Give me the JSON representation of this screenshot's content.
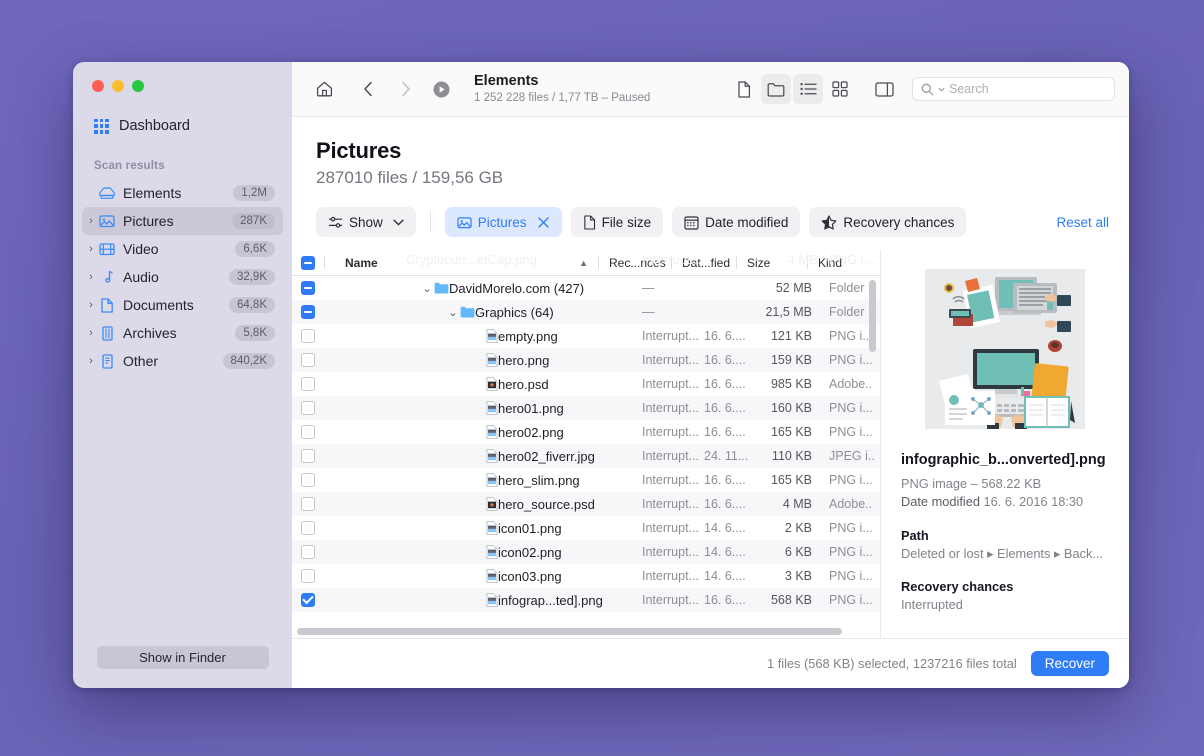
{
  "window": {
    "traffic_lights": [
      "close",
      "minimize",
      "zoom"
    ],
    "accent": "#2f7df6"
  },
  "sidebar": {
    "dashboard_label": "Dashboard",
    "section_title": "Scan results",
    "items": [
      {
        "label": "Elements",
        "badge": "1,2M",
        "icon": "disk-icon",
        "expandable": false,
        "selected": false
      },
      {
        "label": "Pictures",
        "badge": "287K",
        "icon": "picture-icon",
        "expandable": true,
        "selected": true
      },
      {
        "label": "Video",
        "badge": "6,6K",
        "icon": "video-icon",
        "expandable": true,
        "selected": false
      },
      {
        "label": "Audio",
        "badge": "32,9K",
        "icon": "audio-icon",
        "expandable": true,
        "selected": false
      },
      {
        "label": "Documents",
        "badge": "64,8K",
        "icon": "document-icon",
        "expandable": true,
        "selected": false
      },
      {
        "label": "Archives",
        "badge": "5,8K",
        "icon": "archive-icon",
        "expandable": true,
        "selected": false
      },
      {
        "label": "Other",
        "badge": "840,2K",
        "icon": "other-icon",
        "expandable": true,
        "selected": false
      }
    ],
    "show_in_finder_label": "Show in Finder"
  },
  "toolbar": {
    "home_icon": "home-icon",
    "back_icon": "chevron-left-icon",
    "forward_icon": "chevron-right-icon",
    "play_icon": "play-circle-icon",
    "title": "Elements",
    "subtitle": "1 252 228 files / 1,77 TB – Paused",
    "view_buttons": [
      {
        "name": "file-view-icon",
        "active": false
      },
      {
        "name": "folder-view-icon",
        "active": true
      },
      {
        "name": "list-view-icon",
        "active": true
      },
      {
        "name": "grid-view-icon",
        "active": false
      }
    ],
    "sidebar_toggle_icon": "sidebar-toggle-icon",
    "search_placeholder": "Search",
    "search_value": ""
  },
  "header": {
    "title": "Pictures",
    "subtitle": "287010 files / 159,56 GB"
  },
  "filters": {
    "show_label": "Show",
    "chips": [
      {
        "label": "Pictures",
        "icon": "picture-icon",
        "active": true,
        "removable": true
      },
      {
        "label": "File size",
        "icon": "document-icon",
        "active": false,
        "removable": false
      },
      {
        "label": "Date modified",
        "icon": "calendar-icon",
        "active": false,
        "removable": false
      },
      {
        "label": "Recovery chances",
        "icon": "star-icon",
        "active": false,
        "removable": false
      }
    ],
    "reset_label": "Reset all"
  },
  "table": {
    "columns": [
      "Name",
      "Rec...nces",
      "Dat...fied",
      "Size",
      "Kind"
    ],
    "sort_column": "Name",
    "sort_direction": "asc",
    "header_checkbox_state": "mixed",
    "ghost_row_name": "Cryptocurr...etCap.png",
    "ghost_row_rec": "Interrupt...",
    "ghost_row_size": "4 MB",
    "ghost_row_kind": "PNG i...",
    "rows": [
      {
        "check": "mixed",
        "indent": 0,
        "disclosure": "open",
        "type": "folder",
        "name": "DavidMorelo.com (427)",
        "rec": "",
        "date": "",
        "size": "52 MB",
        "kind": "Folder",
        "dash": "—"
      },
      {
        "check": "mixed",
        "indent": 1,
        "disclosure": "open",
        "type": "folder",
        "name": "Graphics (64)",
        "rec": "",
        "date": "",
        "size": "21,5 MB",
        "kind": "Folder",
        "dash": "—"
      },
      {
        "check": "unchecked",
        "indent": 2,
        "disclosure": "none",
        "type": "png",
        "name": "empty.png",
        "rec": "Interrupt...",
        "date": "16. 6....",
        "size": "121 KB",
        "kind": "PNG i...",
        "dash": ""
      },
      {
        "check": "unchecked",
        "indent": 2,
        "disclosure": "none",
        "type": "png",
        "name": "hero.png",
        "rec": "Interrupt...",
        "date": "16. 6....",
        "size": "159 KB",
        "kind": "PNG i...",
        "dash": ""
      },
      {
        "check": "unchecked",
        "indent": 2,
        "disclosure": "none",
        "type": "psd",
        "name": "hero.psd",
        "rec": "Interrupt...",
        "date": "16. 6....",
        "size": "985 KB",
        "kind": "Adobe..",
        "dash": ""
      },
      {
        "check": "unchecked",
        "indent": 2,
        "disclosure": "none",
        "type": "png",
        "name": "hero01.png",
        "rec": "Interrupt...",
        "date": "16. 6....",
        "size": "160 KB",
        "kind": "PNG i...",
        "dash": ""
      },
      {
        "check": "unchecked",
        "indent": 2,
        "disclosure": "none",
        "type": "png",
        "name": "hero02.png",
        "rec": "Interrupt...",
        "date": "16. 6....",
        "size": "165 KB",
        "kind": "PNG i...",
        "dash": ""
      },
      {
        "check": "unchecked",
        "indent": 2,
        "disclosure": "none",
        "type": "png",
        "name": "hero02_fiverr.jpg",
        "rec": "Interrupt...",
        "date": "24. 11...",
        "size": "110 KB",
        "kind": "JPEG i..",
        "dash": ""
      },
      {
        "check": "unchecked",
        "indent": 2,
        "disclosure": "none",
        "type": "png",
        "name": "hero_slim.png",
        "rec": "Interrupt...",
        "date": "16. 6....",
        "size": "165 KB",
        "kind": "PNG i...",
        "dash": ""
      },
      {
        "check": "unchecked",
        "indent": 2,
        "disclosure": "none",
        "type": "psd",
        "name": "hero_source.psd",
        "rec": "Interrupt...",
        "date": "16. 6....",
        "size": "4 MB",
        "kind": "Adobe..",
        "dash": ""
      },
      {
        "check": "unchecked",
        "indent": 2,
        "disclosure": "none",
        "type": "png",
        "name": "icon01.png",
        "rec": "Interrupt...",
        "date": "14. 6....",
        "size": "2 KB",
        "kind": "PNG i...",
        "dash": ""
      },
      {
        "check": "unchecked",
        "indent": 2,
        "disclosure": "none",
        "type": "png",
        "name": "icon02.png",
        "rec": "Interrupt...",
        "date": "14. 6....",
        "size": "6 KB",
        "kind": "PNG i...",
        "dash": ""
      },
      {
        "check": "unchecked",
        "indent": 2,
        "disclosure": "none",
        "type": "png",
        "name": "icon03.png",
        "rec": "Interrupt...",
        "date": "14. 6....",
        "size": "3 KB",
        "kind": "PNG i...",
        "dash": ""
      },
      {
        "check": "checked",
        "indent": 2,
        "disclosure": "none",
        "type": "png",
        "name": "infograp...ted].png",
        "rec": "Interrupt...",
        "date": "16. 6....",
        "size": "568 KB",
        "kind": "PNG i...",
        "dash": ""
      }
    ]
  },
  "preview": {
    "thumbnail_alt": "desktop-workspace-illustration",
    "file_name": "infographic_b...onverted].png",
    "file_meta": "PNG image – 568.22 KB",
    "date_label": "Date modified",
    "date_value": "16. 6. 2016 18:30",
    "path_heading": "Path",
    "path_value": "Deleted or lost ▸ Elements ▸ Back...",
    "recovery_heading": "Recovery chances",
    "recovery_value": "Interrupted"
  },
  "footer": {
    "status": "1 files (568 KB) selected, 1237216 files total",
    "recover_label": "Recover"
  }
}
